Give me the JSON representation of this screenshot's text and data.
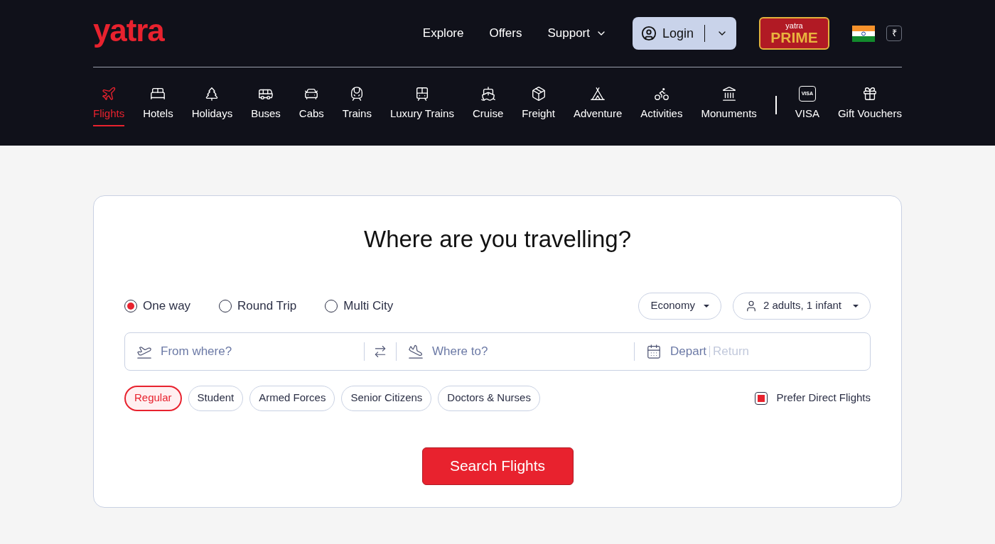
{
  "header": {
    "logo": "yatra",
    "links": [
      {
        "label": "Explore",
        "dropdown": false
      },
      {
        "label": "Offers",
        "dropdown": false
      },
      {
        "label": "Support",
        "dropdown": true
      }
    ],
    "login": "Login",
    "prime": {
      "small": "yatra",
      "big": "PRIME"
    },
    "currency": "₹"
  },
  "nav": {
    "items": [
      {
        "label": "Flights",
        "selected": true
      },
      {
        "label": "Hotels",
        "selected": false
      },
      {
        "label": "Holidays",
        "selected": false
      },
      {
        "label": "Buses",
        "selected": false
      },
      {
        "label": "Cabs",
        "selected": false
      },
      {
        "label": "Trains",
        "selected": false
      },
      {
        "label": "Luxury Trains",
        "selected": false
      },
      {
        "label": "Cruise",
        "selected": false
      },
      {
        "label": "Freight",
        "selected": false
      },
      {
        "label": "Adventure",
        "selected": false
      },
      {
        "label": "Activities",
        "selected": false
      },
      {
        "label": "Monuments",
        "selected": false
      }
    ],
    "extra": [
      {
        "label": "VISA",
        "badge": "VISA"
      },
      {
        "label": "Gift Vouchers"
      }
    ]
  },
  "search": {
    "title": "Where are you travelling?",
    "trip_types": [
      {
        "label": "One way",
        "selected": true
      },
      {
        "label": "Round Trip",
        "selected": false
      },
      {
        "label": "Multi City",
        "selected": false
      }
    ],
    "cabin": "Economy",
    "travellers": "2 adults, 1 infant",
    "from": {
      "placeholder": "From where?"
    },
    "to": {
      "placeholder": "Where to?"
    },
    "depart": "Depart",
    "return": "Return",
    "fares": [
      {
        "label": "Regular",
        "selected": true
      },
      {
        "label": "Student",
        "selected": false
      },
      {
        "label": "Armed Forces",
        "selected": false
      },
      {
        "label": "Senior Citizens",
        "selected": false
      },
      {
        "label": "Doctors & Nurses",
        "selected": false
      }
    ],
    "direct": {
      "label": "Prefer Direct Flights",
      "checked": true
    },
    "button": "Search Flights"
  }
}
